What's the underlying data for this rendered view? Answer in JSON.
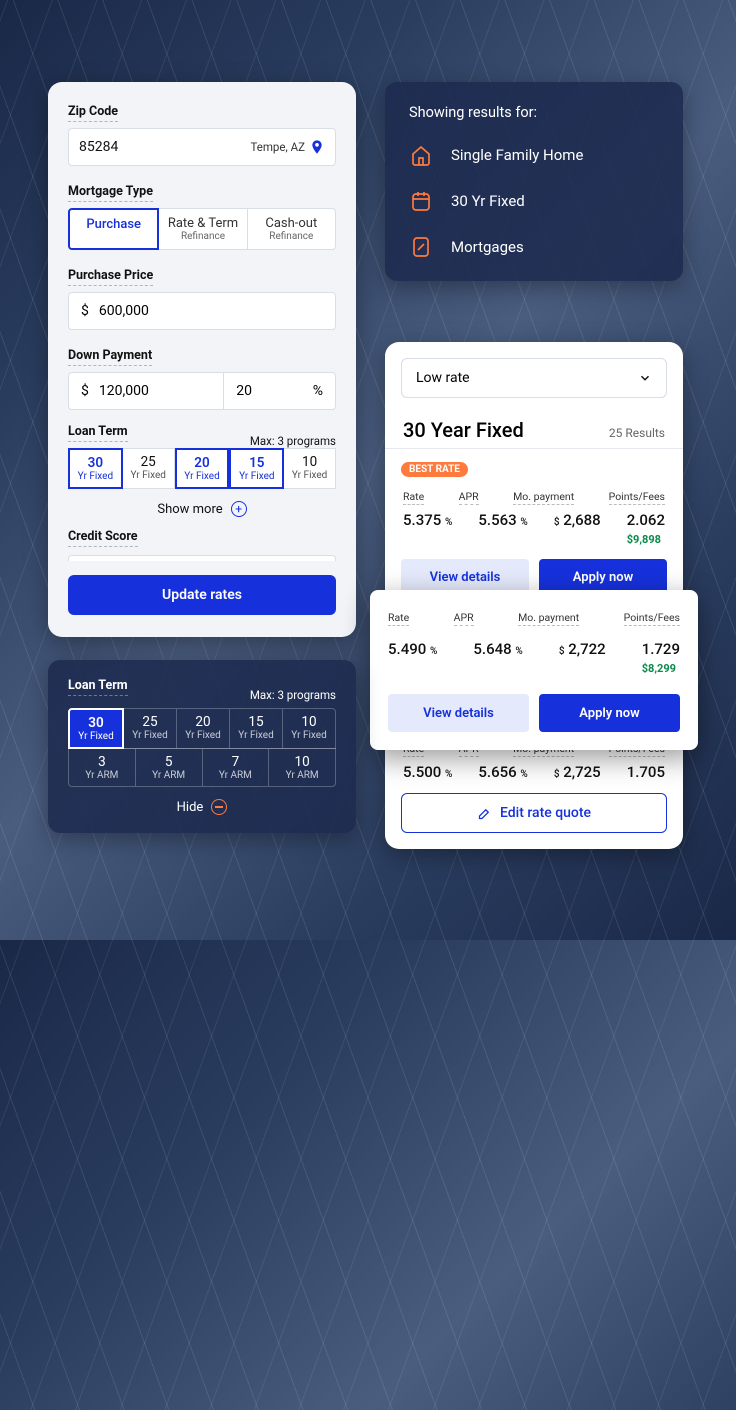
{
  "form": {
    "zip_label": "Zip Code",
    "zip_value": "85284",
    "zip_city": "Tempe, AZ",
    "mtype_label": "Mortgage Type",
    "mtype_opts": [
      {
        "t1": "Purchase",
        "t2": ""
      },
      {
        "t1": "Rate & Term",
        "t2": "Refinance"
      },
      {
        "t1": "Cash-out",
        "t2": "Refinance"
      }
    ],
    "price_label": "Purchase Price",
    "price_sym": "$",
    "price_value": "600,000",
    "dp_label": "Down Payment",
    "dp_value": "120,000",
    "dp_pct": "20",
    "dp_pct_sym": "%",
    "lt_label": "Loan Term",
    "lt_max": "Max: 3 programs",
    "lt_cells": [
      {
        "n": "30",
        "s": "Yr Fixed",
        "sel": true
      },
      {
        "n": "25",
        "s": "Yr Fixed",
        "sel": false
      },
      {
        "n": "20",
        "s": "Yr Fixed",
        "sel": true
      },
      {
        "n": "15",
        "s": "Yr Fixed",
        "sel": true
      },
      {
        "n": "10",
        "s": "Yr Fixed",
        "sel": false
      }
    ],
    "show_more": "Show more",
    "credit_label": "Credit Score",
    "update_btn": "Update rates"
  },
  "results": {
    "header": "Showing results for:",
    "rows": [
      "Single Family Home",
      "30 Yr Fixed",
      "Mortgages"
    ]
  },
  "rates": {
    "sort": "Low rate",
    "title": "30 Year Fixed",
    "count": "25 Results",
    "badge": "BEST RATE",
    "labels": {
      "rate": "Rate",
      "apr": "APR",
      "mo": "Mo. payment",
      "pf": "Points/Fees"
    },
    "o1": {
      "rate": "5.375",
      "apr": "5.563",
      "mo": "2,688",
      "pts": "2.062",
      "fee": "$9,898"
    },
    "o3": {
      "rate": "5.500",
      "apr": "5.656",
      "mo": "2,725",
      "pts": "1.705"
    },
    "pct": "%",
    "dol": "$",
    "view": "View details",
    "apply": "Apply now",
    "edit": "Edit rate quote"
  },
  "float": {
    "rate": "5.490",
    "apr": "5.648",
    "mo": "2,722",
    "pts": "1.729",
    "fee": "$8,299"
  },
  "lt_dark": {
    "label": "Loan Term",
    "max": "Max: 3 programs",
    "row1": [
      {
        "n": "30",
        "s": "Yr Fixed",
        "sel": true
      },
      {
        "n": "25",
        "s": "Yr Fixed"
      },
      {
        "n": "20",
        "s": "Yr Fixed"
      },
      {
        "n": "15",
        "s": "Yr Fixed"
      },
      {
        "n": "10",
        "s": "Yr Fixed"
      }
    ],
    "row2": [
      {
        "n": "3",
        "s": "Yr ARM"
      },
      {
        "n": "5",
        "s": "Yr ARM"
      },
      {
        "n": "7",
        "s": "Yr ARM"
      },
      {
        "n": "10",
        "s": "Yr ARM"
      }
    ],
    "hide": "Hide"
  }
}
